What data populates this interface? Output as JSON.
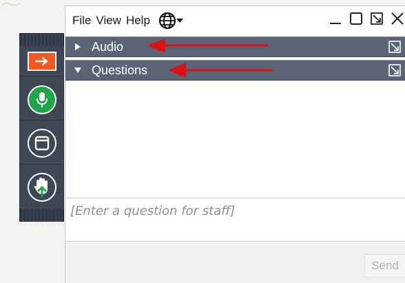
{
  "menu": {
    "file": "File",
    "view": "View",
    "help": "Help"
  },
  "window_controls": {
    "minimize": "minimize-icon",
    "maximize": "maximize-icon",
    "restore": "restore-icon",
    "close": "close-icon"
  },
  "panels": {
    "audio": {
      "label": "Audio",
      "expanded": false
    },
    "questions": {
      "label": "Questions",
      "expanded": true
    }
  },
  "question_input": {
    "placeholder": "[Enter a question for staff]"
  },
  "send_label": "Send",
  "colors": {
    "toolbar_bg": "#3f4754",
    "panel_header_bg": "#5a6475",
    "arrow_orange": "#f05a22",
    "mic_green": "#1fa447",
    "annotation_red": "#e01010"
  },
  "toolbar_icons": [
    "arrow-right-icon",
    "microphone-icon",
    "window-icon",
    "raise-hand-icon"
  ]
}
